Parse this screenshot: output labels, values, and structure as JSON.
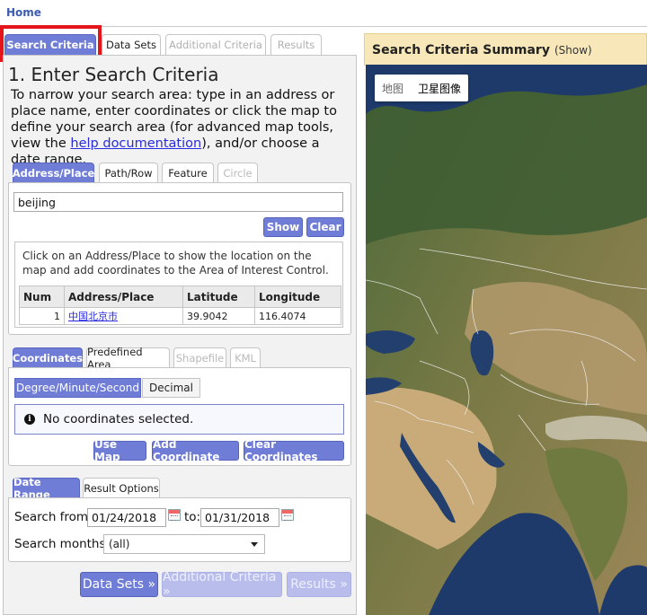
{
  "nav": {
    "home": "Home"
  },
  "main_tabs": [
    {
      "label": "Search Criteria",
      "state": "active"
    },
    {
      "label": "Data Sets",
      "state": "normal"
    },
    {
      "label": "Additional Criteria",
      "state": "disabled"
    },
    {
      "label": "Results",
      "state": "disabled"
    }
  ],
  "step": {
    "title": "1. Enter Search Criteria",
    "intro_before": "To narrow your search area: type in an address or place name, enter coordinates or click the map to define your search area (for advanced map tools, view the ",
    "intro_link": "help documentation",
    "intro_after": "), and/or choose a date range."
  },
  "location_tabs": [
    "Address/Place",
    "Path/Row",
    "Feature",
    "Circle"
  ],
  "address": {
    "value": "beijing",
    "show_button": "Show",
    "clear_button": "Clear",
    "hint": "Click on an Address/Place to show the location on the map and add coordinates to the Area of Interest Control.",
    "columns": [
      "Num",
      "Address/Place",
      "Latitude",
      "Longitude"
    ],
    "rows": [
      {
        "num": "1",
        "place": "中国北京市",
        "lat": "39.9042",
        "lon": "116.4074"
      }
    ]
  },
  "coord_tabs": [
    "Coordinates",
    "Predefined Area",
    "Shapefile",
    "KML"
  ],
  "coords": {
    "format_options": [
      "Degree/Minute/Second",
      "Decimal"
    ],
    "empty_message": "No coordinates selected.",
    "use_map": "Use Map",
    "add_coordinate": "Add Coordinate",
    "clear_coordinates": "Clear Coordinates"
  },
  "date_tabs": [
    "Date Range",
    "Result Options"
  ],
  "dates": {
    "from_label": "Search from:",
    "from_value": "01/24/2018",
    "to_label": "to:",
    "to_value": "01/31/2018",
    "months_label": "Search months:",
    "months_value": "(all)"
  },
  "footer_buttons": {
    "data_sets": "Data Sets »",
    "additional": "Additional Criteria »",
    "results": "Results »"
  },
  "summary": {
    "title": "Search Criteria Summary",
    "show": "(Show)"
  },
  "map": {
    "type_map": "地图",
    "type_satellite": "卫星图像"
  },
  "colors": {
    "accent": "#6f7dd6",
    "highlight": "#e5141b",
    "summary_bg": "#f8e8b9"
  }
}
